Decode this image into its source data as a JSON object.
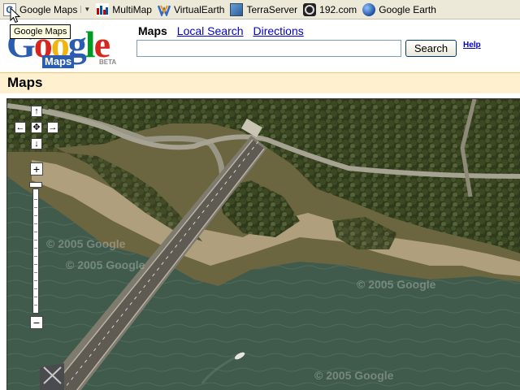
{
  "bookmarks": [
    {
      "label": "Google Maps",
      "icon": "google-g-icon",
      "dropdown": true
    },
    {
      "label": "MultiMap",
      "icon": "multimap-icon"
    },
    {
      "label": "VirtualEarth",
      "icon": "virtualearth-icon"
    },
    {
      "label": "TerraServer",
      "icon": "terraserver-icon"
    },
    {
      "label": "192.com",
      "icon": "192-icon"
    },
    {
      "label": "Google Earth",
      "icon": "google-earth-icon"
    }
  ],
  "tooltip": "Google Maps",
  "logo": {
    "letters": [
      "G",
      "o",
      "o",
      "g",
      "l",
      "e"
    ],
    "maps": "Maps",
    "beta": "BETA"
  },
  "nav": {
    "current": "Maps",
    "local_search": "Local Search",
    "directions": "Directions"
  },
  "search": {
    "value": "",
    "button": "Search"
  },
  "help": "Help",
  "page_title": "Maps",
  "map_controls": {
    "up": "↑",
    "left": "←",
    "center": "✥",
    "right": "→",
    "down": "↓",
    "zoom_in": "+",
    "zoom_out": "−"
  },
  "watermarks": [
    "© 2005 Google",
    "© 2005 Google",
    "© 2005 Google",
    "© 2005 Google"
  ],
  "colors": {
    "title_bar": "#fff1cf",
    "link": "#0000cc",
    "water": "#3f5a4c"
  }
}
